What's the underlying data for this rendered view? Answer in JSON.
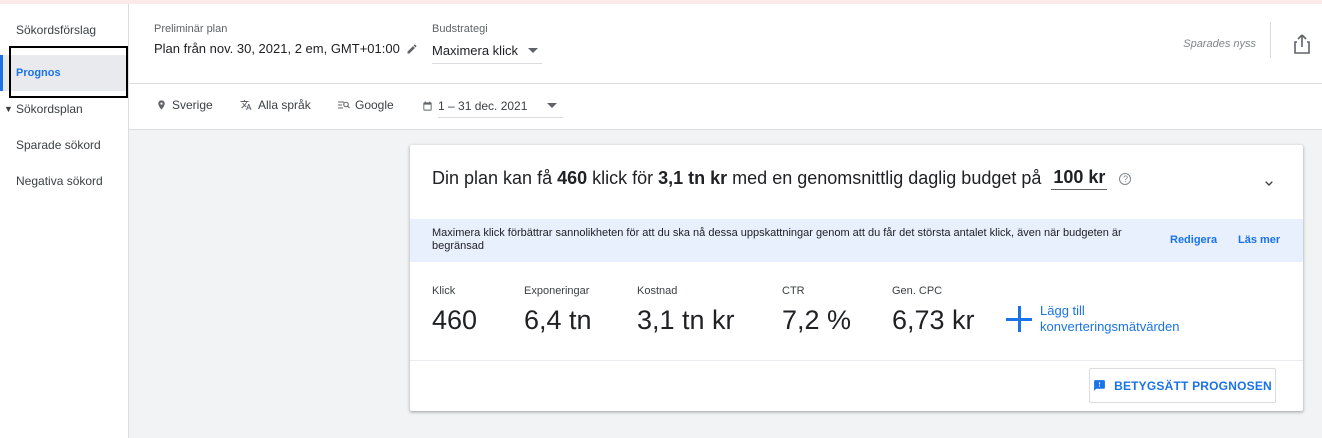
{
  "sidebar": {
    "items": [
      {
        "label": "Sökordsförslag"
      },
      {
        "label": "Prognos"
      },
      {
        "label": "Sökordsplan"
      },
      {
        "label": "Sparade sökord"
      },
      {
        "label": "Negativa sökord"
      }
    ]
  },
  "header": {
    "plan_label": "Preliminär plan",
    "plan_value": "Plan från nov. 30, 2021, 2 em, GMT+01:00",
    "bid_label": "Budstrategi",
    "bid_value": "Maximera klick",
    "saved_status": "Sparades nyss"
  },
  "filters": {
    "location": "Sverige",
    "language": "Alla språk",
    "network": "Google",
    "date_range": "1 – 31 dec. 2021"
  },
  "forecast": {
    "summary_prefix": "Din plan kan få",
    "clicks_value": "460",
    "clicks_word": "klick för",
    "cost_value": "3,1 tn kr",
    "summary_middle": "med en genomsnittlig daglig budget på",
    "budget_value": "100 kr",
    "help_glyph": "?",
    "banner_text": "Maximera klick förbättrar sannolikheten för att du ska nå dessa uppskattningar genom att du får det största antalet klick, även när budgeten är begränsad",
    "banner_edit": "Redigera",
    "banner_more": "Läs mer",
    "metrics": [
      {
        "label": "Klick",
        "value": "460"
      },
      {
        "label": "Exponeringar",
        "value": "6,4 tn"
      },
      {
        "label": "Kostnad",
        "value": "3,1 tn kr"
      },
      {
        "label": "CTR",
        "value": "7,2 %"
      },
      {
        "label": "Gen. CPC",
        "value": "6,73 kr"
      }
    ],
    "add_conversion_line1": "Lägg till",
    "add_conversion_line2": "konverteringsmätvärden",
    "rate_button": "BETYGSÄTT PROGNOSEN"
  },
  "colors": {
    "accent": "#1a73e8",
    "banner_bg": "#e8f0fe",
    "page_bg": "#f1f3f4"
  }
}
